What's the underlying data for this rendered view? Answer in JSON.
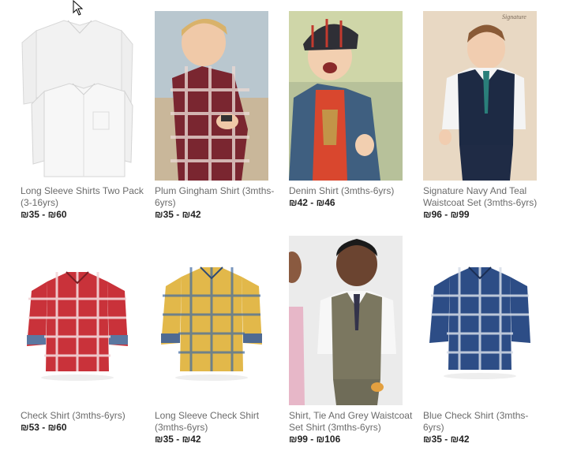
{
  "products": [
    {
      "title": "Long Sleeve Shirts Two Pack (3-16yrs)",
      "price": "₪35 - ₪60"
    },
    {
      "title": "Plum Gingham Shirt (3mths-6yrs)",
      "price": "₪35 - ₪42"
    },
    {
      "title": "Denim Shirt (3mths-6yrs)",
      "price": "₪42 - ₪46"
    },
    {
      "title": "Signature Navy And Teal Waistcoat Set (3mths-6yrs)",
      "price": "₪96 - ₪99"
    },
    {
      "title": "Check Shirt (3mths-6yrs)",
      "price": "₪53 - ₪60"
    },
    {
      "title": "Long Sleeve Check Shirt (3mths-6yrs)",
      "price": "₪35 - ₪42"
    },
    {
      "title": "Shirt, Tie And Grey Waistcoat Set Shirt (3mths-6yrs)",
      "price": "₪99 - ₪106"
    },
    {
      "title": "Blue Check Shirt (3mths-6yrs)",
      "price": "₪35 - ₪42"
    }
  ],
  "colors": {
    "title_text": "#6b6b6b",
    "price_text": "#222222"
  }
}
